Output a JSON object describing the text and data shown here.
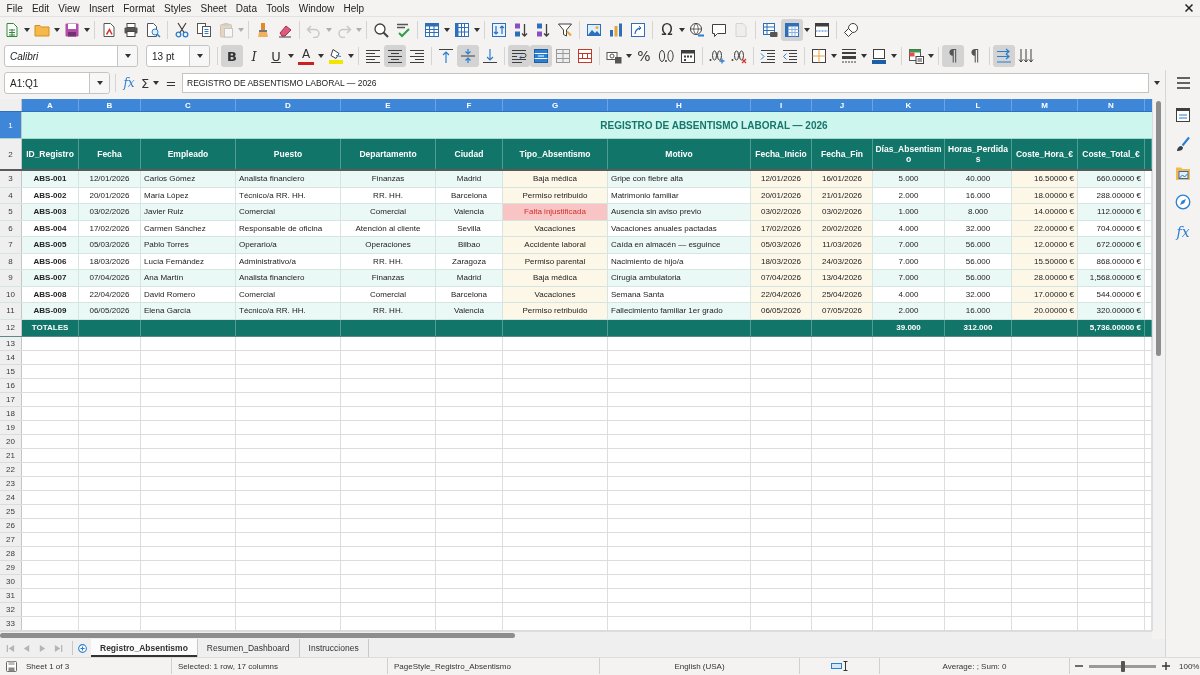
{
  "menu_bar": {
    "items": [
      "File",
      "Edit",
      "View",
      "Insert",
      "Format",
      "Styles",
      "Sheet",
      "Data",
      "Tools",
      "Window",
      "Help"
    ]
  },
  "standard_toolbar": {
    "groups": [
      {
        "buttons": [
          {
            "kind": "new",
            "on": false,
            "disabled": false,
            "dropdown": true
          },
          {
            "kind": "open",
            "on": false,
            "disabled": false,
            "dropdown": true
          },
          {
            "kind": "save",
            "on": false,
            "disabled": false,
            "dropdown": true
          }
        ]
      },
      {
        "buttons": [
          {
            "kind": "pdf",
            "on": false,
            "disabled": false,
            "dropdown": false
          },
          {
            "kind": "print",
            "on": false,
            "disabled": false,
            "dropdown": false
          },
          {
            "kind": "preview",
            "on": false,
            "disabled": false,
            "dropdown": false
          }
        ]
      },
      {
        "buttons": [
          {
            "kind": "cut",
            "on": false,
            "disabled": false,
            "dropdown": false
          },
          {
            "kind": "copy",
            "on": false,
            "disabled": false,
            "dropdown": false
          },
          {
            "kind": "paste",
            "on": false,
            "disabled": true,
            "dropdown": true
          }
        ]
      },
      {
        "buttons": [
          {
            "kind": "clone",
            "on": false,
            "disabled": false,
            "dropdown": false
          },
          {
            "kind": "clear",
            "on": false,
            "disabled": false,
            "dropdown": false
          }
        ]
      },
      {
        "buttons": [
          {
            "kind": "undo",
            "on": false,
            "disabled": true,
            "dropdown": true
          },
          {
            "kind": "redo",
            "on": false,
            "disabled": true,
            "dropdown": true
          }
        ]
      },
      {
        "buttons": [
          {
            "kind": "find",
            "on": false,
            "disabled": false,
            "dropdown": false
          },
          {
            "kind": "spelling",
            "on": false,
            "disabled": false,
            "dropdown": false
          }
        ]
      },
      {
        "buttons": [
          {
            "kind": "row",
            "on": false,
            "disabled": false,
            "dropdown": true
          },
          {
            "kind": "column",
            "on": false,
            "disabled": false,
            "dropdown": true
          }
        ]
      },
      {
        "buttons": [
          {
            "kind": "sort",
            "on": false,
            "disabled": false,
            "dropdown": false
          },
          {
            "kind": "ascending",
            "on": false,
            "disabled": false,
            "dropdown": false
          },
          {
            "kind": "descending",
            "on": false,
            "disabled": false,
            "dropdown": false
          },
          {
            "kind": "filter",
            "on": false,
            "disabled": false,
            "dropdown": false
          }
        ]
      },
      {
        "buttons": [
          {
            "kind": "image",
            "on": false,
            "disabled": false,
            "dropdown": false
          },
          {
            "kind": "chart",
            "on": false,
            "disabled": false,
            "dropdown": false
          },
          {
            "kind": "pivot",
            "on": false,
            "disabled": false,
            "dropdown": false
          }
        ]
      },
      {
        "buttons": [
          {
            "kind": "special",
            "glyph": "Ω",
            "on": false,
            "disabled": false,
            "dropdown": true
          },
          {
            "kind": "hyperlink",
            "on": false,
            "disabled": false,
            "dropdown": false
          },
          {
            "kind": "comment",
            "on": false,
            "disabled": false,
            "dropdown": false
          },
          {
            "kind": "headerfooter",
            "on": false,
            "disabled": true,
            "dropdown": false
          }
        ]
      },
      {
        "buttons": [
          {
            "kind": "printarea",
            "on": false,
            "disabled": false,
            "dropdown": false
          },
          {
            "kind": "freeze",
            "on": true,
            "disabled": false,
            "dropdown": true
          },
          {
            "kind": "split",
            "on": false,
            "disabled": false,
            "dropdown": false
          }
        ]
      },
      {
        "buttons": [
          {
            "kind": "draw",
            "on": false,
            "disabled": false,
            "dropdown": false
          }
        ]
      }
    ]
  },
  "formatting_toolbar": {
    "font_name": "Calibri",
    "font_size": "13 pt",
    "groups": [
      {
        "buttons": [
          {
            "kind": "bold",
            "glyph": "B",
            "on": true,
            "disabled": false,
            "dropdown": false
          },
          {
            "kind": "italic",
            "glyph": "I",
            "on": false,
            "disabled": false,
            "dropdown": false
          },
          {
            "kind": "underline",
            "glyph": "U",
            "on": false,
            "disabled": false,
            "dropdown": true
          },
          {
            "kind": "fontcolor",
            "glyph": "A",
            "on": false,
            "disabled": false,
            "dropdown": true
          },
          {
            "kind": "highlight",
            "on": false,
            "disabled": false,
            "dropdown": true
          }
        ]
      },
      {
        "buttons": [
          {
            "kind": "left",
            "on": false,
            "disabled": false,
            "dropdown": false
          },
          {
            "kind": "center",
            "on": true,
            "disabled": false,
            "dropdown": false
          },
          {
            "kind": "right",
            "on": false,
            "disabled": false,
            "dropdown": false
          }
        ]
      },
      {
        "buttons": [
          {
            "kind": "top",
            "on": false,
            "disabled": false,
            "dropdown": false
          },
          {
            "kind": "middle",
            "on": true,
            "disabled": false,
            "dropdown": false
          },
          {
            "kind": "bottom",
            "on": false,
            "disabled": false,
            "dropdown": false
          }
        ]
      },
      {
        "buttons": [
          {
            "kind": "wrap",
            "on": true,
            "disabled": false,
            "dropdown": false
          },
          {
            "kind": "mergecenter",
            "on": true,
            "disabled": false,
            "dropdown": false
          },
          {
            "kind": "unmerge",
            "on": false,
            "disabled": false,
            "dropdown": false
          },
          {
            "kind": "merge",
            "on": false,
            "disabled": false,
            "dropdown": false
          }
        ]
      },
      {
        "buttons": [
          {
            "kind": "currency",
            "on": false,
            "disabled": false,
            "dropdown": true
          },
          {
            "kind": "percent",
            "glyph": "%",
            "on": false,
            "disabled": false,
            "dropdown": false
          },
          {
            "kind": "number",
            "on": false,
            "disabled": false,
            "dropdown": false
          },
          {
            "kind": "date",
            "on": false,
            "disabled": false,
            "dropdown": false
          }
        ]
      },
      {
        "buttons": [
          {
            "kind": "adddecimal",
            "on": false,
            "disabled": false,
            "dropdown": false
          },
          {
            "kind": "deletedecimal",
            "on": false,
            "disabled": false,
            "dropdown": false
          }
        ]
      },
      {
        "buttons": [
          {
            "kind": "indent",
            "on": false,
            "disabled": false,
            "dropdown": false
          },
          {
            "kind": "outdent",
            "on": false,
            "disabled": false,
            "dropdown": false
          }
        ]
      },
      {
        "buttons": [
          {
            "kind": "borders",
            "on": false,
            "disabled": false,
            "dropdown": true
          },
          {
            "kind": "linestyle",
            "on": false,
            "disabled": false,
            "dropdown": true
          },
          {
            "kind": "bordercolor",
            "on": false,
            "disabled": false,
            "dropdown": true
          }
        ]
      },
      {
        "buttons": [
          {
            "kind": "conditional",
            "on": false,
            "disabled": false,
            "dropdown": true
          }
        ]
      },
      {
        "buttons": [
          {
            "kind": "ltr",
            "glyph": "¶",
            "on": true,
            "disabled": false,
            "dropdown": false
          },
          {
            "kind": "rtl",
            "glyph": "¶",
            "on": false,
            "disabled": false,
            "dropdown": false
          }
        ]
      },
      {
        "buttons": [
          {
            "kind": "textdirection",
            "on": true,
            "disabled": false,
            "dropdown": false
          },
          {
            "kind": "verticaltext",
            "on": false,
            "disabled": false,
            "dropdown": false
          }
        ]
      }
    ]
  },
  "formula_bar": {
    "name_box": "A1:Q1",
    "wizard": "fx",
    "sum": "Σ",
    "equals": "=",
    "formula": "REGISTRO DE ABSENTISMO LABORAL — 2026"
  },
  "sheet": {
    "column_letters": [
      {
        "label": "A",
        "selected": true
      },
      {
        "label": "B",
        "selected": true
      },
      {
        "label": "C",
        "selected": true
      },
      {
        "label": "D",
        "selected": true
      },
      {
        "label": "E",
        "selected": true
      },
      {
        "label": "F",
        "selected": true
      },
      {
        "label": "G",
        "selected": true
      },
      {
        "label": "H",
        "selected": true
      },
      {
        "label": "I",
        "selected": true
      },
      {
        "label": "J",
        "selected": true
      },
      {
        "label": "K",
        "selected": true
      },
      {
        "label": "L",
        "selected": true
      },
      {
        "label": "M",
        "selected": true
      },
      {
        "label": "N",
        "selected": true
      }
    ],
    "row_numbers": [
      {
        "label": "1",
        "selected": true
      },
      {
        "label": "2",
        "selected": false
      },
      {
        "label": "3",
        "selected": false
      },
      {
        "label": "4",
        "selected": false
      },
      {
        "label": "5",
        "selected": false
      },
      {
        "label": "6",
        "selected": false
      },
      {
        "label": "7",
        "selected": false
      },
      {
        "label": "8",
        "selected": false
      },
      {
        "label": "9",
        "selected": false
      },
      {
        "label": "10",
        "selected": false
      },
      {
        "label": "11",
        "selected": false
      },
      {
        "label": "12",
        "selected": false
      },
      {
        "label": "13",
        "selected": false
      },
      {
        "label": "14",
        "selected": false
      },
      {
        "label": "15",
        "selected": false
      },
      {
        "label": "16",
        "selected": false
      },
      {
        "label": "17",
        "selected": false
      },
      {
        "label": "18",
        "selected": false
      },
      {
        "label": "19",
        "selected": false
      },
      {
        "label": "20",
        "selected": false
      },
      {
        "label": "21",
        "selected": false
      },
      {
        "label": "22",
        "selected": false
      },
      {
        "label": "23",
        "selected": false
      },
      {
        "label": "24",
        "selected": false
      },
      {
        "label": "25",
        "selected": false
      },
      {
        "label": "26",
        "selected": false
      },
      {
        "label": "27",
        "selected": false
      },
      {
        "label": "28",
        "selected": false
      },
      {
        "label": "29",
        "selected": false
      },
      {
        "label": "30",
        "selected": false
      },
      {
        "label": "31",
        "selected": false
      },
      {
        "label": "32",
        "selected": false
      },
      {
        "label": "33",
        "selected": false
      }
    ],
    "title": "REGISTRO DE ABSENTISMO LABORAL — 2026",
    "headers": [
      "ID_Registro",
      "Fecha",
      "Empleado",
      "Puesto",
      "Departamento",
      "Ciudad",
      "Tipo_Absentismo",
      "Motivo",
      "Fecha_Inicio",
      "Fecha_Fin",
      "Días_Absentismo",
      "Horas_Perdidas",
      "Coste_Hora_€",
      "Coste_Total_€"
    ],
    "rows": [
      {
        "flagged": false,
        "cells": [
          "ABS-001",
          "12/01/2026",
          "Carlos Gómez",
          "Analista financiero",
          "Finanzas",
          "Madrid",
          "Baja médica",
          "Gripe con fiebre alta",
          "12/01/2026",
          "16/01/2026",
          "5.000",
          "40.000",
          "16.50000 €",
          "660.00000 €"
        ]
      },
      {
        "flagged": false,
        "cells": [
          "ABS-002",
          "20/01/2026",
          "María López",
          "Técnico/a RR. HH.",
          "RR. HH.",
          "Barcelona",
          "Permiso retribuido",
          "Matrimonio familiar",
          "20/01/2026",
          "21/01/2026",
          "2.000",
          "16.000",
          "18.00000 €",
          "288.00000 €"
        ]
      },
      {
        "flagged": true,
        "cells": [
          "ABS-003",
          "03/02/2026",
          "Javier Ruiz",
          "Comercial",
          "Comercial",
          "Valencia",
          "Falta injustificada",
          "Ausencia sin aviso previo",
          "03/02/2026",
          "03/02/2026",
          "1.000",
          "8.000",
          "14.00000 €",
          "112.00000 €"
        ]
      },
      {
        "flagged": false,
        "cells": [
          "ABS-004",
          "17/02/2026",
          "Carmen Sánchez",
          "Responsable de oficina",
          "Atención al cliente",
          "Sevilla",
          "Vacaciones",
          "Vacaciones anuales pactadas",
          "17/02/2026",
          "20/02/2026",
          "4.000",
          "32.000",
          "22.00000 €",
          "704.00000 €"
        ]
      },
      {
        "flagged": false,
        "cells": [
          "ABS-005",
          "05/03/2026",
          "Pablo Torres",
          "Operario/a",
          "Operaciones",
          "Bilbao",
          "Accidente laboral",
          "Caída en almacén — esguince",
          "05/03/2026",
          "11/03/2026",
          "7.000",
          "56.000",
          "12.00000 €",
          "672.00000 €"
        ]
      },
      {
        "flagged": false,
        "cells": [
          "ABS-006",
          "18/03/2026",
          "Lucía Fernández",
          "Administrativo/a",
          "RR. HH.",
          "Zaragoza",
          "Permiso parental",
          "Nacimiento de hijo/a",
          "18/03/2026",
          "24/03/2026",
          "7.000",
          "56.000",
          "15.50000 €",
          "868.00000 €"
        ]
      },
      {
        "flagged": false,
        "cells": [
          "ABS-007",
          "07/04/2026",
          "Ana Martín",
          "Analista financiero",
          "Finanzas",
          "Madrid",
          "Baja médica",
          "Cirugía ambulatoria",
          "07/04/2026",
          "13/04/2026",
          "7.000",
          "56.000",
          "28.00000 €",
          "1,568.00000 €"
        ]
      },
      {
        "flagged": false,
        "cells": [
          "ABS-008",
          "22/04/2026",
          "David Romero",
          "Comercial",
          "Comercial",
          "Barcelona",
          "Vacaciones",
          "Semana Santa",
          "22/04/2026",
          "25/04/2026",
          "4.000",
          "32.000",
          "17.00000 €",
          "544.00000 €"
        ]
      },
      {
        "flagged": false,
        "cells": [
          "ABS-009",
          "06/05/2026",
          "Elena García",
          "Técnico/a RR. HH.",
          "RR. HH.",
          "Valencia",
          "Permiso retribuido",
          "Fallecimiento familiar 1er grado",
          "06/05/2026",
          "07/05/2026",
          "2.000",
          "16.000",
          "20.00000 €",
          "320.00000 €"
        ]
      }
    ],
    "totals": {
      "label": "TOTALES",
      "dias": "39.000",
      "horas": "312.000",
      "coste_total": "5,736.00000 €"
    }
  },
  "sheet_tabs": [
    {
      "label": "Registro_Absentismo",
      "selected": true
    },
    {
      "label": "Resumen_Dashboard",
      "selected": false
    },
    {
      "label": "Instrucciones",
      "selected": false
    }
  ],
  "sidebar": {
    "buttons": [
      {
        "kind": "properties"
      },
      {
        "kind": "styles"
      },
      {
        "kind": "gallery"
      },
      {
        "kind": "navigator"
      },
      {
        "kind": "functions",
        "glyph": "fx"
      }
    ]
  },
  "status_bar": {
    "sheet": "Sheet 1 of 3",
    "selection": "Selected: 1 row, 17 columns",
    "page_style": "PageStyle_Registro_Absentismo",
    "language": "English (USA)",
    "summary": "Average: ; Sum: 0",
    "zoom": {
      "level": 0.5,
      "reading": "100%"
    }
  }
}
